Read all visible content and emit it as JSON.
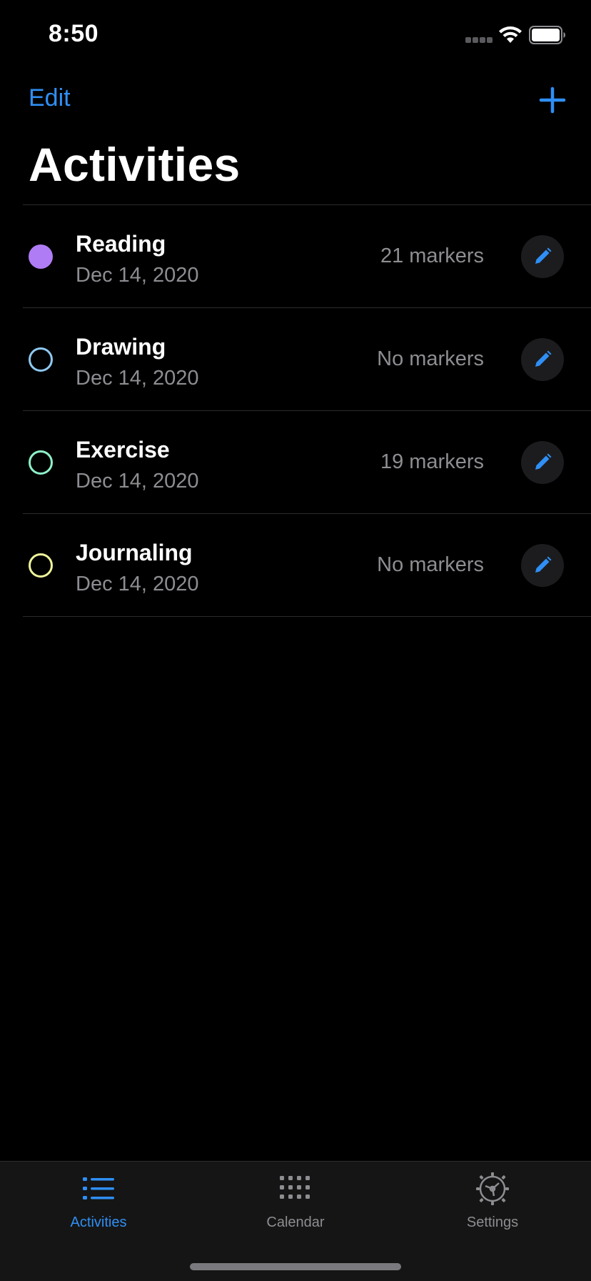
{
  "status_bar": {
    "time": "8:50"
  },
  "nav": {
    "edit_label": "Edit",
    "add_icon": "plus-icon",
    "title": "Activities"
  },
  "activities": [
    {
      "name": "Reading",
      "date": "Dec 14, 2020",
      "markers": "21 markers",
      "color": "#b07cf5",
      "filled": true
    },
    {
      "name": "Drawing",
      "date": "Dec 14, 2020",
      "markers": "No markers",
      "color": "#8ec8f0",
      "filled": false
    },
    {
      "name": "Exercise",
      "date": "Dec 14, 2020",
      "markers": "19 markers",
      "color": "#8ef0c8",
      "filled": false
    },
    {
      "name": "Journaling",
      "date": "Dec 14, 2020",
      "markers": "No markers",
      "color": "#eef59a",
      "filled": false
    }
  ],
  "tab_bar": {
    "tabs": [
      {
        "label": "Activities",
        "icon": "list-icon",
        "active": true
      },
      {
        "label": "Calendar",
        "icon": "calendar-grid-icon",
        "active": false
      },
      {
        "label": "Settings",
        "icon": "gear-icon",
        "active": false
      }
    ]
  },
  "colors": {
    "accent": "#2f8ff5",
    "inactive": "#8d8d92",
    "background": "#000000"
  }
}
